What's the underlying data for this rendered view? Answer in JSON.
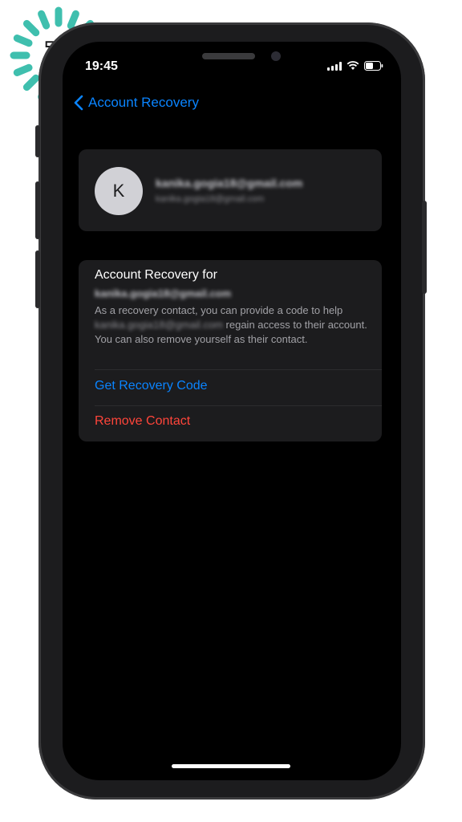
{
  "status_bar": {
    "time": "19:45"
  },
  "nav": {
    "back_label": "Account Recovery"
  },
  "profile": {
    "avatar_letter": "K",
    "email": "kanika.gogia18@gmail.com",
    "sub_email": "kanika.gogia18@gmail.com"
  },
  "recovery": {
    "title": "Account Recovery for",
    "email": "kanika.gogia18@gmail.com",
    "desc_part1": "As a recovery contact, you can provide a code to help",
    "desc_email": "kanika.gogia18@gmail.com",
    "desc_part2": "regain access to their account. You can also remove yourself as their contact.",
    "get_code_label": "Get Recovery Code",
    "remove_label": "Remove Contact"
  },
  "logo": {
    "letter": "T"
  },
  "colors": {
    "accent": "#0a84ff",
    "destructive": "#ff453a",
    "logo_teal": "#3fbfae"
  }
}
